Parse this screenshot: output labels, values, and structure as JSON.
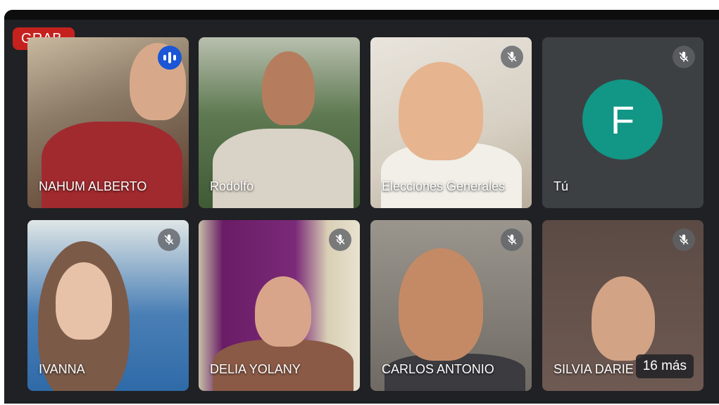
{
  "recording": {
    "label": "GRAB."
  },
  "participants": [
    {
      "name": "NAHUM ALBERTO",
      "mic": "speaking"
    },
    {
      "name": "Rodolfo",
      "mic": "none"
    },
    {
      "name": "Elecciones Generales",
      "mic": "muted"
    },
    {
      "name": "Tú",
      "mic": "muted",
      "avatar_letter": "F",
      "avatar_color": "#129685"
    },
    {
      "name": "IVANNA",
      "mic": "muted"
    },
    {
      "name": "DELIA YOLANY",
      "mic": "muted"
    },
    {
      "name": "CARLOS ANTONIO",
      "mic": "muted"
    },
    {
      "name": "SILVIA DARIE",
      "mic": "muted"
    }
  ],
  "overflow": {
    "label": "16 más"
  },
  "colors": {
    "recording": "#c5221f",
    "speaking": "#1a56d6",
    "background": "#202124"
  }
}
